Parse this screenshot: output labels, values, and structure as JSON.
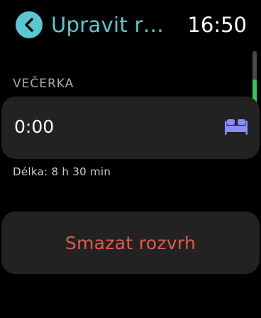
{
  "header": {
    "title": "Upravit r…",
    "time": "16:50",
    "back_icon": "chevron-left-icon"
  },
  "section": {
    "label": "VEČERKA"
  },
  "bedtime": {
    "value": "0:00",
    "icon": "bed-icon"
  },
  "duration": {
    "text": "Délka: 8 h 30 min"
  },
  "actions": {
    "delete_label": "Smazat rozvrh"
  },
  "scrollbar": {
    "position_fraction": 0.5
  },
  "colors": {
    "accent": "#5ac8d0",
    "destructive": "#e35a4a",
    "bed_icon": "#8b8cf5",
    "scroll_thumb": "#34c759",
    "card_bg": "#222222"
  }
}
